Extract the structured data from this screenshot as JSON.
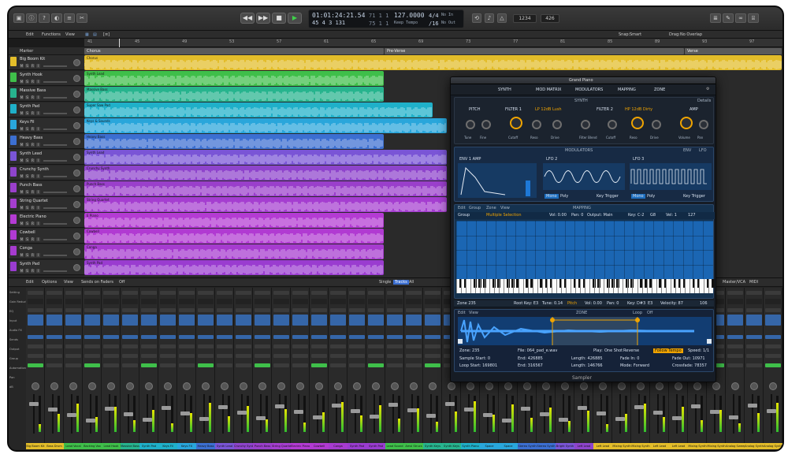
{
  "control_bar": {
    "lcd": {
      "position_time": "01:01:24:21.54",
      "position_bars": "45  4  3  131",
      "beat_a": "71  1  1",
      "beat_b": "75  1  1",
      "tempo": "127.0000",
      "tempo_label": "Keep Tempo",
      "signature": "4/4",
      "division": "/16",
      "in_label": "No In",
      "out_label": "No Out"
    },
    "right_readouts": [
      "1234",
      "426"
    ]
  },
  "toolbar": {
    "edit": "Edit",
    "functions": "Functions",
    "view": "View",
    "snap_label": "Snap:",
    "snap_value": "Smart",
    "drag_label": "Drag:",
    "drag_value": "No Overlap"
  },
  "ruler": {
    "bars": [
      "41",
      "45",
      "49",
      "53",
      "57",
      "61",
      "65",
      "69",
      "73",
      "77",
      "81",
      "85",
      "89",
      "93",
      "97"
    ]
  },
  "markers": {
    "header": "Marker",
    "sections": [
      {
        "label": "Chorus",
        "start": 0
      },
      {
        "label": "Pre-Verse",
        "start": 0.43
      },
      {
        "label": "Verse",
        "start": 0.86
      }
    ]
  },
  "tracks": [
    {
      "name": "Big Boom Kit",
      "color": "#e3bd2a"
    },
    {
      "name": "Synth Hook",
      "color": "#3fbf4a"
    },
    {
      "name": "Massive Bass",
      "color": "#27b48e"
    },
    {
      "name": "Synth Pad",
      "color": "#1fb0c9"
    },
    {
      "name": "Keys Fil",
      "color": "#29a6db"
    },
    {
      "name": "Heavy Bass",
      "color": "#3c6fd1"
    },
    {
      "name": "Synth Lead",
      "color": "#7a55d6"
    },
    {
      "name": "Crunchy Synth",
      "color": "#8e44cc"
    },
    {
      "name": "Punch Bass",
      "color": "#9a3fcb"
    },
    {
      "name": "String Quartet",
      "color": "#a53ed0"
    },
    {
      "name": "Electric Piano",
      "color": "#b43bd3"
    },
    {
      "name": "Cowbell",
      "color": "#b13ad2"
    },
    {
      "name": "Conga",
      "color": "#a63bcf"
    },
    {
      "name": "Synth Pad",
      "color": "#9a3cd0"
    }
  ],
  "regions": [
    {
      "row": 0,
      "start": 0,
      "end": 1,
      "label": "Chorus"
    },
    {
      "row": 1,
      "start": 0,
      "end": 0.43,
      "label": "Synth Lead"
    },
    {
      "row": 2,
      "start": 0,
      "end": 0.43,
      "label": "Massive Bass"
    },
    {
      "row": 3,
      "start": 0,
      "end": 0.5,
      "label": "Super Saw Pad"
    },
    {
      "row": 4,
      "start": 0,
      "end": 0.52,
      "label": "Keys & Sounds"
    },
    {
      "row": 5,
      "start": 0,
      "end": 0.43,
      "label": "Heavy Bass"
    },
    {
      "row": 6,
      "start": 0,
      "end": 0.52,
      "label": "Synth Lead"
    },
    {
      "row": 7,
      "start": 0,
      "end": 0.52,
      "label": "Crunchy Synth"
    },
    {
      "row": 8,
      "start": 0,
      "end": 0.52,
      "label": "Punch Bass"
    },
    {
      "row": 9,
      "start": 0,
      "end": 0.52,
      "label": "String Quartet"
    },
    {
      "row": 10,
      "start": 0,
      "end": 0.43,
      "label": "E Piano"
    },
    {
      "row": 11,
      "start": 0,
      "end": 0.43,
      "label": "Cowbell"
    },
    {
      "row": 12,
      "start": 0,
      "end": 0.43,
      "label": "Conga"
    },
    {
      "row": 13,
      "start": 0,
      "end": 0.43,
      "label": "Synth Pad"
    }
  ],
  "sampler": {
    "title": "Grand Piano",
    "footer": "Sampler",
    "tabs": [
      "SYNTH",
      "MOD MATRIX",
      "MODULATORS",
      "MAPPING",
      "ZONE"
    ],
    "synth": {
      "header": "SYNTH",
      "sections": [
        "PITCH",
        "FILTER 1",
        "FILTER 2",
        "AMP"
      ],
      "filter1_type": "LP 12dB Lush",
      "filter2_type": "HP 12dB Dirty",
      "knobs": [
        "Tune",
        "Fine",
        "Cutoff",
        "Reso",
        "Drive",
        "Filter Blend",
        "Cutoff",
        "Reso",
        "Drive",
        "Volume",
        "Pan"
      ],
      "details_button": "Details"
    },
    "modulators": {
      "header": "MODULATORS",
      "env": "ENV 1 AMP",
      "lfo2": "LFO 2",
      "lfo3": "LFO 3",
      "mode_buttons": [
        "Mono",
        "Poly",
        "Key Trigger"
      ],
      "env_buttons": [
        "ENV",
        "LFO"
      ]
    },
    "mapping": {
      "header": "MAPPING",
      "controls": [
        "Edit",
        "Group",
        "Zone",
        "View"
      ],
      "group_label": "Group",
      "selection": "Multiple Selection",
      "vol": "Vol: 0.00",
      "pan": "Pan: 0",
      "output": "Output: Main",
      "key": "Key: C-2",
      "key_to": "G8",
      "vel": "Vel: 1",
      "vel_to": "127"
    },
    "zone_bar": {
      "zone": "Zone 235",
      "root_key": "Root Key: E3",
      "tune": "Tune: 0.14",
      "pitch": "Pitch",
      "vol": "Vol: 0.00",
      "pan": "Pan: 0",
      "key": "Key: D#3",
      "key_to": "E3",
      "velocity": "Velocity: 87",
      "velocity_to": "106"
    },
    "zone": {
      "header": "ZONE",
      "edit": "Edit",
      "view": "View",
      "loop_label": "Loop",
      "loop_value": "Off",
      "zone": "Zone: 235",
      "file": "File: 064_pad_e.wav",
      "play": "Play:",
      "one_shot": "One Shot",
      "reverse": "Reverse",
      "follow_tempo": "Follow Tempo",
      "speed": "Speed: 1/1",
      "sample_start": "Sample Start: 0",
      "end": "End: 426885",
      "length": "Length: 426885",
      "fade_in": "Fade In: 0",
      "fade_out": "Fade Out: 10971",
      "loop_start": "Loop Start: 169801",
      "loop_end": "End: 316567",
      "loop_length": "Length: 146766",
      "mode": "Mode: Forward",
      "crossfade": "Crossfade: 78357"
    }
  },
  "mixer": {
    "toolbar": [
      "Edit",
      "Options",
      "View",
      "Sends on Faders",
      "Off",
      "Single",
      "Tracks",
      "All",
      "Master/VCA",
      "MIDI"
    ],
    "rows": [
      "Setting",
      "Gain Reduction",
      "EQ",
      "Input",
      "Audio FX",
      "Sends",
      "Output",
      "Group",
      "Automation",
      "Pan",
      "dB"
    ],
    "strips": [
      {
        "name": "Big Boom Kit",
        "color": "#e3bd2a"
      },
      {
        "name": "Bass Drum",
        "color": "#e3bd2a"
      },
      {
        "name": "Lead Vocal",
        "color": "#3fbf4a"
      },
      {
        "name": "Backing Vox",
        "color": "#3fbf4a"
      },
      {
        "name": "Lead Hook",
        "color": "#3fbf4a"
      },
      {
        "name": "Massive Bass",
        "color": "#27b48e"
      },
      {
        "name": "Synth Pad",
        "color": "#1fb0c9"
      },
      {
        "name": "Keys Fil",
        "color": "#1fb0c9"
      },
      {
        "name": "Keys FX",
        "color": "#29a6db"
      },
      {
        "name": "Heavy Bass",
        "color": "#3c6fd1"
      },
      {
        "name": "Synth Lead",
        "color": "#7a55d6"
      },
      {
        "name": "Crunchy Synth",
        "color": "#8e44cc"
      },
      {
        "name": "Punch Bass",
        "color": "#9a3fcb"
      },
      {
        "name": "String Quartet",
        "color": "#a53ed0"
      },
      {
        "name": "Electric Piano",
        "color": "#b43bd3"
      },
      {
        "name": "Cowbell",
        "color": "#b13ad2"
      },
      {
        "name": "Conga",
        "color": "#a63bcf"
      },
      {
        "name": "Synth Pad",
        "color": "#9a3cd0"
      },
      {
        "name": "Synth Pad",
        "color": "#9a3cd0"
      },
      {
        "name": "Lead Sound",
        "color": "#3fbf4a"
      },
      {
        "name": "Amsl Strucs",
        "color": "#3fbf4a"
      },
      {
        "name": "Synth Keys",
        "color": "#27b48e"
      },
      {
        "name": "Synth Keys",
        "color": "#27b48e"
      },
      {
        "name": "Synth Piano",
        "color": "#1fb0c9"
      },
      {
        "name": "Space",
        "color": "#29a6db"
      },
      {
        "name": "Space",
        "color": "#29a6db"
      },
      {
        "name": "Stereo Synth",
        "color": "#3c6fd1"
      },
      {
        "name": "Stereo Synth",
        "color": "#3c6fd1"
      },
      {
        "name": "Bright Synth",
        "color": "#7a55d6"
      },
      {
        "name": "Left Lead",
        "color": "#8e44cc"
      },
      {
        "name": "Left Lead",
        "color": "#e3bd2a"
      },
      {
        "name": "Mixing Synth",
        "color": "#e3bd2a"
      },
      {
        "name": "Mixing Synth",
        "color": "#e3bd2a"
      },
      {
        "name": "Left Lead",
        "color": "#e3bd2a"
      },
      {
        "name": "Left Lead",
        "color": "#e3bd2a"
      },
      {
        "name": "Mixing Synth",
        "color": "#e3bd2a"
      },
      {
        "name": "Mixing Synth",
        "color": "#e3bd2a"
      },
      {
        "name": "Analog Sweep",
        "color": "#e3bd2a"
      },
      {
        "name": "Analog Synth",
        "color": "#e3bd2a"
      },
      {
        "name": "Analog Synth",
        "color": "#e3bd2a"
      }
    ]
  }
}
